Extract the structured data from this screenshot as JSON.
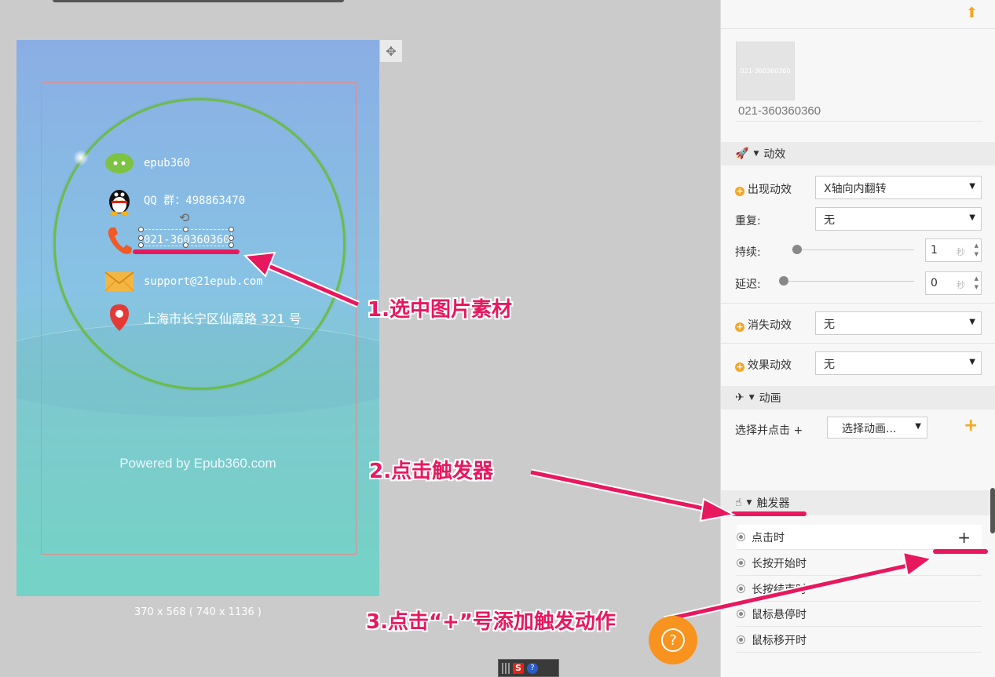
{
  "canvas": {
    "contacts": [
      {
        "icon": "wechat-icon",
        "text": "epub360"
      },
      {
        "icon": "qq-penguin-icon",
        "text": "QQ 群：498863470"
      },
      {
        "icon": "phone-icon",
        "text": "021-360360360"
      },
      {
        "icon": "mail-icon",
        "text": "support@21epub.com"
      },
      {
        "icon": "location-pin-icon",
        "text": "上海市长宁区仙霞路 321 号"
      }
    ],
    "powered_by": "Powered by Epub360.com",
    "dimensions": "370 x 568 ( 740 x 1136 )"
  },
  "panel": {
    "thumb_overlay": "021-360360360",
    "asset_name": "021-360360360",
    "effects_section": "动效",
    "appear_label": "出现动效",
    "appear_value": "X轴向内翻转",
    "repeat_label": "重复:",
    "repeat_value": "无",
    "duration_label": "持续:",
    "duration_value": "1",
    "delay_label": "延迟:",
    "delay_value": "0",
    "seconds_unit": "秒",
    "disappear_label": "消失动效",
    "disappear_value": "无",
    "effect_label": "效果动效",
    "effect_value": "无",
    "animation_section": "动画",
    "select_click_label": "选择并点击 +",
    "select_animation": "选择动画...",
    "trigger_section": "触发器",
    "triggers": [
      "点击时",
      "长按开始时",
      "长按结束时",
      "鼠标悬停时",
      "鼠标移开时"
    ]
  },
  "annotations": {
    "step1": "1.选中图片素材",
    "step2": "2.点击触发器",
    "step3": "3.点击“+”号添加触发动作"
  },
  "colors": {
    "accent": "#f5a623",
    "annotation": "#e8185f",
    "ring": "#6dbb4a"
  }
}
